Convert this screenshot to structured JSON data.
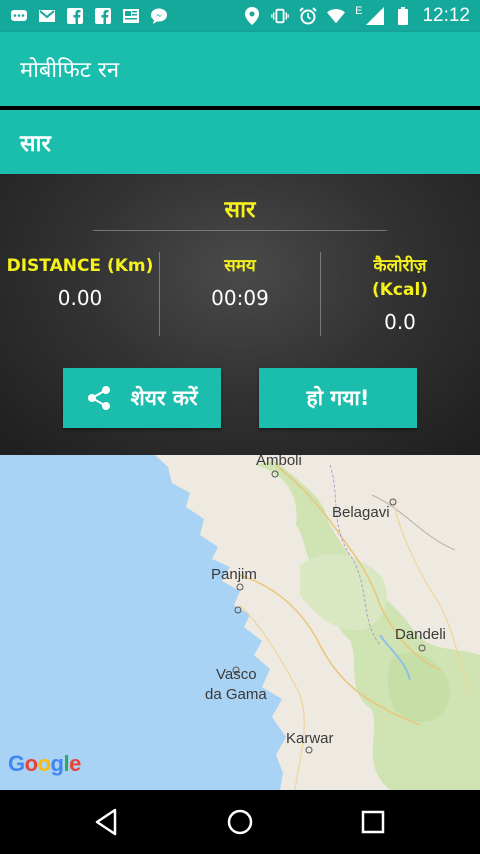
{
  "status_bar": {
    "time": "12:12",
    "network_label": "E",
    "icons": [
      "chat-icon",
      "gmail-icon",
      "facebook-icon",
      "facebook-icon",
      "news-icon",
      "messenger-icon",
      "location-icon",
      "vibrate-icon",
      "alarm-icon",
      "wifi-icon",
      "signal-icon",
      "battery-icon"
    ]
  },
  "app_bar": {
    "title": "मोबीफिट रन"
  },
  "section": {
    "title": "सार"
  },
  "summary": {
    "heading": "सार",
    "distance": {
      "label": "DISTANCE (Km)",
      "value": "0.00"
    },
    "time": {
      "label": "समय",
      "value": "00:09"
    },
    "calories": {
      "label_line1": "कैलोरीज़",
      "label_line2": "(Kcal)",
      "value": "0.0"
    },
    "share_button": "शेयर करें",
    "done_button": "हो गया!"
  },
  "map": {
    "labels": {
      "amboli": "Amboli",
      "belagavi": "Belagavi",
      "panjim": "Panjim",
      "dandeli": "Dandeli",
      "vasco1": "Vasco",
      "vasco2": "da Gama",
      "karwar": "Karwar"
    },
    "provider": "Google",
    "colors": {
      "sea": "#a9d3f5",
      "land": "#eeeae2",
      "forest": "#cfe3b3"
    }
  },
  "colors": {
    "accent": "#1bbdad",
    "status_bar": "#15a99c",
    "highlight": "#f4f11d"
  }
}
